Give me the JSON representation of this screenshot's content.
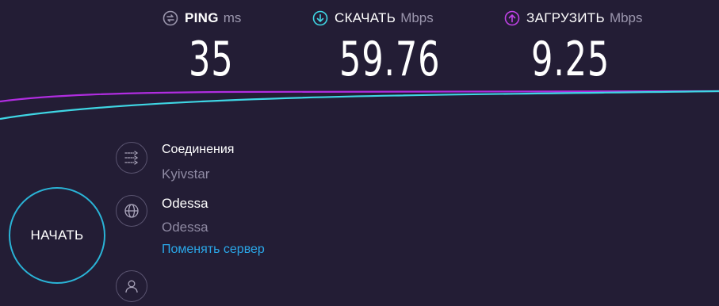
{
  "metrics": {
    "ping": {
      "label": "PING",
      "unit": "ms",
      "value": "35",
      "icon": "ping-icon",
      "color": "#9b96ad"
    },
    "download": {
      "label": "СКАЧАТЬ",
      "unit": "Mbps",
      "value": "59.76",
      "icon": "download-arrow-icon",
      "color": "#3fd6e4"
    },
    "upload": {
      "label": "ЗАГРУЗИТЬ",
      "unit": "Mbps",
      "value": "9.25",
      "icon": "upload-arrow-icon",
      "color": "#c042e6"
    }
  },
  "graph": {
    "download_color": "#3fd6e4",
    "upload_color": "#b02de0"
  },
  "start_button": {
    "label": "НАЧАТЬ",
    "border_color": "#2ab3d6"
  },
  "connection": {
    "title": "Соединения",
    "provider": "Kyivstar",
    "icon": "connections-icon"
  },
  "server": {
    "name": "Odessa",
    "location": "Odessa",
    "change_link": "Поменять сервер",
    "icon": "globe-icon"
  },
  "user": {
    "icon": "user-icon"
  }
}
